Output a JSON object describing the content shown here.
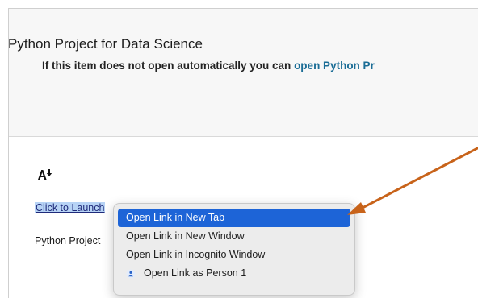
{
  "page": {
    "title": "Python Project for Data Science",
    "auto_open_prefix": "If this item does not open automatically you can ",
    "auto_open_link": "open Python Pr"
  },
  "content": {
    "launch_link": "Click to Launch",
    "project_label": "Python Project",
    "text_size_icon": "text-size-icon"
  },
  "context_menu": {
    "items": [
      {
        "label": "Open Link in New Tab",
        "active": true
      },
      {
        "label": "Open Link in New Window",
        "active": false
      },
      {
        "label": "Open Link in Incognito Window",
        "active": false
      },
      {
        "label": "Open Link as Person 1",
        "active": false,
        "icon": "person-icon"
      }
    ]
  },
  "annotation": {
    "arrow_color": "#c8631a"
  },
  "colors": {
    "accent": "#1b6d96",
    "menu_highlight": "#1d64d7",
    "selection": "#b7d3f5"
  }
}
